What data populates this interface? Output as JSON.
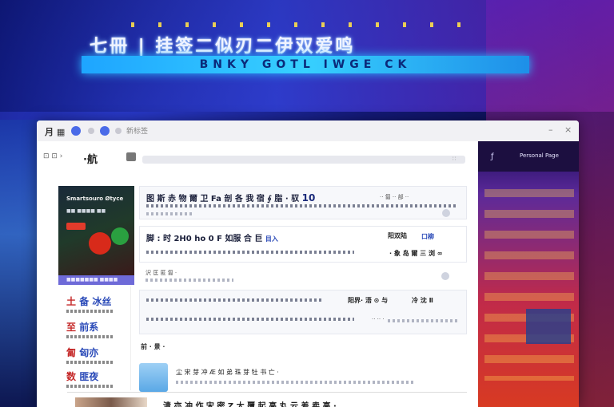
{
  "banner": {
    "title": "七冊 | 挂签二似刃二伊双爱鸣",
    "subtitle": "BNKY  GOTL  IWGE  CK"
  },
  "window": {
    "titlebar": {
      "logo": "月 ▦",
      "tab_label": "新标签",
      "minimize": "–",
      "close": "×"
    },
    "address": {
      "back_label": "⊡ ⊡ ›",
      "site_name": "·航",
      "end_label": "∷"
    },
    "side_panel": {
      "icon": "ƒ",
      "title": "Personal Page"
    },
    "promo": {
      "title": "Smartsouro Øtyce",
      "subtitle": "■■ ■■■■ ■■",
      "bar": "■■■■■■■  ■■■■"
    },
    "left_list": [
      {
        "head_a": "土",
        "head_b": "备 冰丝"
      },
      {
        "head_a": "至",
        "head_b": "前系"
      },
      {
        "head_a": "匐",
        "head_b": "匈亦"
      },
      {
        "head_a": "数",
        "head_b": "匪夜"
      }
    ],
    "content": {
      "headline1": "图 斯 赤 物 爾 卫 Fa 剖 各 我 宿 ∮ 脂 · 驭",
      "headline1_num": "10",
      "headline1_right": "·· 匐 ·· 部 ··",
      "headline2": "脚 : 时  2H0  ho  0 F 如服 合  巨",
      "headline2_tag": "目入",
      "headline2_right": "阳双陆",
      "headline2_right2": "口柳",
      "row3_right": "· 象 岛 爾 三 浏 ∞",
      "row3_small": "沢 匡 匿 匐 ·",
      "row4_right": "阳界· 浯 ⊙ 与",
      "row4_right2": "冷 沈 Ⅱ",
      "row4_small": "·· ·· ·",
      "section_label_a": "前",
      "section_label_b": "·  景 ·",
      "row5_text": "尘 宋 芽 冲 Æ 如 弟 珠 芽 牡 书 亡 ·",
      "bottom_text": "清 亦 冲 作 宋 密 Z 大 覆 起 高 丸 云 差 卖 高 ·"
    }
  }
}
